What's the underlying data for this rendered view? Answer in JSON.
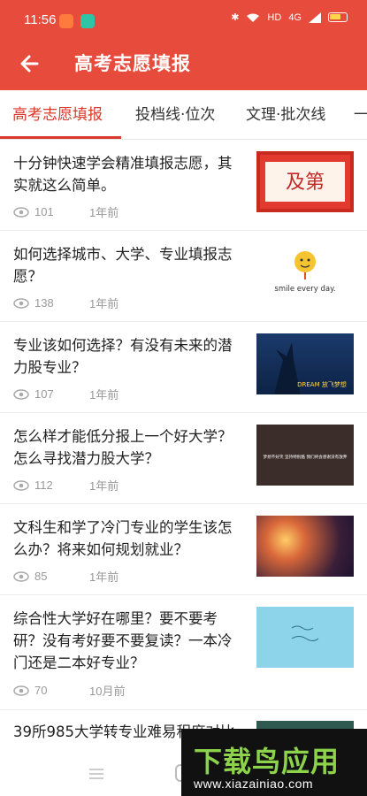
{
  "status_bar": {
    "time": "11:56",
    "hd_label": "HD",
    "signal_label": "4G",
    "app_icon_colors": [
      "#ff6b35",
      "#2ec4a6"
    ]
  },
  "app_bar": {
    "title": "高考志愿填报",
    "back_icon": "arrow-left-icon",
    "color": "#e64b3b"
  },
  "tabs": [
    {
      "label": "高考志愿填报",
      "active": true
    },
    {
      "label": "投档线·位次",
      "active": false
    },
    {
      "label": "文理·批次线",
      "active": false
    },
    {
      "label": "一",
      "active": false
    }
  ],
  "articles": [
    {
      "title": "十分钟快速学会精准填报志愿，其实就这么简单。",
      "views": "101",
      "time": "1年前",
      "thumb_text": "及第"
    },
    {
      "title": "如何选择城市、大学、专业填报志愿？",
      "views": "138",
      "time": "1年前",
      "thumb_text": "smile every day."
    },
    {
      "title": "专业该如何选择？有没有未来的潜力股专业？",
      "views": "107",
      "time": "1年前",
      "thumb_text": "DREAM 放飞梦想"
    },
    {
      "title": "怎么样才能低分报上一个好大学？怎么寻找潜力股大学？",
      "views": "112",
      "time": "1年前",
      "thumb_text": "梦想不好笑 坚持特别酷 我们终会感谢没有放弃"
    },
    {
      "title": "文科生和学了冷门专业的学生该怎么办？将来如何规划就业？",
      "views": "85",
      "time": "1年前",
      "thumb_text": ""
    },
    {
      "title": "综合性大学好在哪里？要不要考研？没有考好要不要复读？一本冷门还是二本好专业？",
      "views": "70",
      "time": "10月前",
      "thumb_text": ""
    },
    {
      "title": "39所985大学转专业难易程度对比",
      "views": "",
      "time": "",
      "thumb_text": ""
    }
  ],
  "watermark": {
    "title": "下载鸟应用",
    "url": "www.xiazainiao.com"
  }
}
